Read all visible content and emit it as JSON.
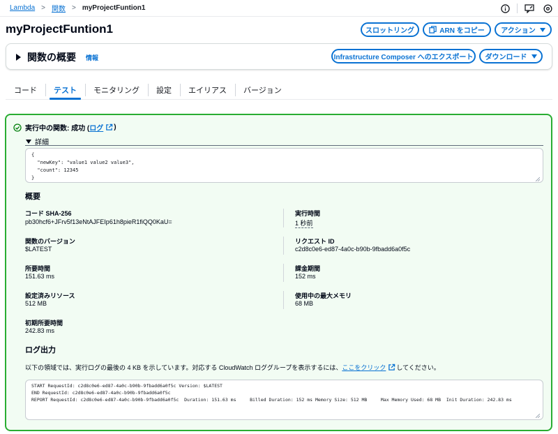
{
  "breadcrumb": {
    "items": [
      "Lambda",
      "関数"
    ],
    "current": "myProjectFuntion1"
  },
  "header": {
    "title": "myProjectFuntion1",
    "buttons": {
      "throttle": "スロットリング",
      "copy_arn": "ARN をコピー",
      "actions": "アクション"
    }
  },
  "overview": {
    "title": "関数の概要",
    "info": "情報",
    "export_button": "Infrastructure Composer へのエクスポート",
    "download_button": "ダウンロード"
  },
  "tabs": [
    {
      "label": "コード",
      "active": false
    },
    {
      "label": "テスト",
      "active": true
    },
    {
      "label": "モニタリング",
      "active": false
    },
    {
      "label": "設定",
      "active": false
    },
    {
      "label": "エイリアス",
      "active": false
    },
    {
      "label": "バージョン",
      "active": false
    }
  ],
  "result": {
    "status_prefix": "実行中の関数: 成功 (",
    "log_link": "ログ",
    "status_suffix": ")",
    "details_label": "詳細",
    "output_json": "{\n  \"newKey\": \"value1 value2 value3\",\n  \"count\": 12345\n}",
    "summary_title": "概要",
    "fields": {
      "code_sha_label": "コード SHA-256",
      "code_sha_value": "pb30hcf6+JFrv5f13eNtAJFEIp61h8pieR1fiQQ0KaU=",
      "exec_time_label": "実行時間",
      "exec_time_value": "1 秒前",
      "version_label": "関数のバージョン",
      "version_value": "$LATEST",
      "request_id_label": "リクエスト ID",
      "request_id_value": "c2d8c0e6-ed87-4a0c-b90b-9fbadd6a0f5c",
      "duration_label": "所要時間",
      "duration_value": "151.63 ms",
      "billed_label": "課金期間",
      "billed_value": "152 ms",
      "resources_label": "設定済みリソース",
      "resources_value": "512 MB",
      "max_memory_label": "使用中の最大メモリ",
      "max_memory_value": "68 MB",
      "init_label": "初期所要時間",
      "init_value": "242.83 ms"
    },
    "log_output_title": "ログ出力",
    "log_desc_prefix": "以下の領域では、実行ログの最後の 4 KB を示しています。対応する CloudWatch ロググループを表示するには、",
    "log_desc_link": "ここをクリック",
    "log_desc_suffix": "してください。",
    "log_text": "START RequestId: c2d8c0e6-ed87-4a0c-b90b-9fbadd6a0f5c Version: $LATEST\nEND RequestId: c2d8c0e6-ed87-4a0c-b90b-9fbadd6a0f5c\nREPORT RequestId: c2d8c0e6-ed87-4a0c-b90b-9fbadd6a0f5c  Duration: 151.63 ms     Billed Duration: 152 ms Memory Size: 512 MB     Max Memory Used: 68 MB  Init Duration: 242.83 ms"
  },
  "icons": {
    "topbar": [
      "info-icon",
      "feedback-icon",
      "settings-icon"
    ],
    "success": "check-circle-icon",
    "external": "external-link-icon"
  },
  "colors": {
    "accent": "#0972d3",
    "success_border": "#29ad32",
    "success_bg": "#f2fcf3"
  }
}
